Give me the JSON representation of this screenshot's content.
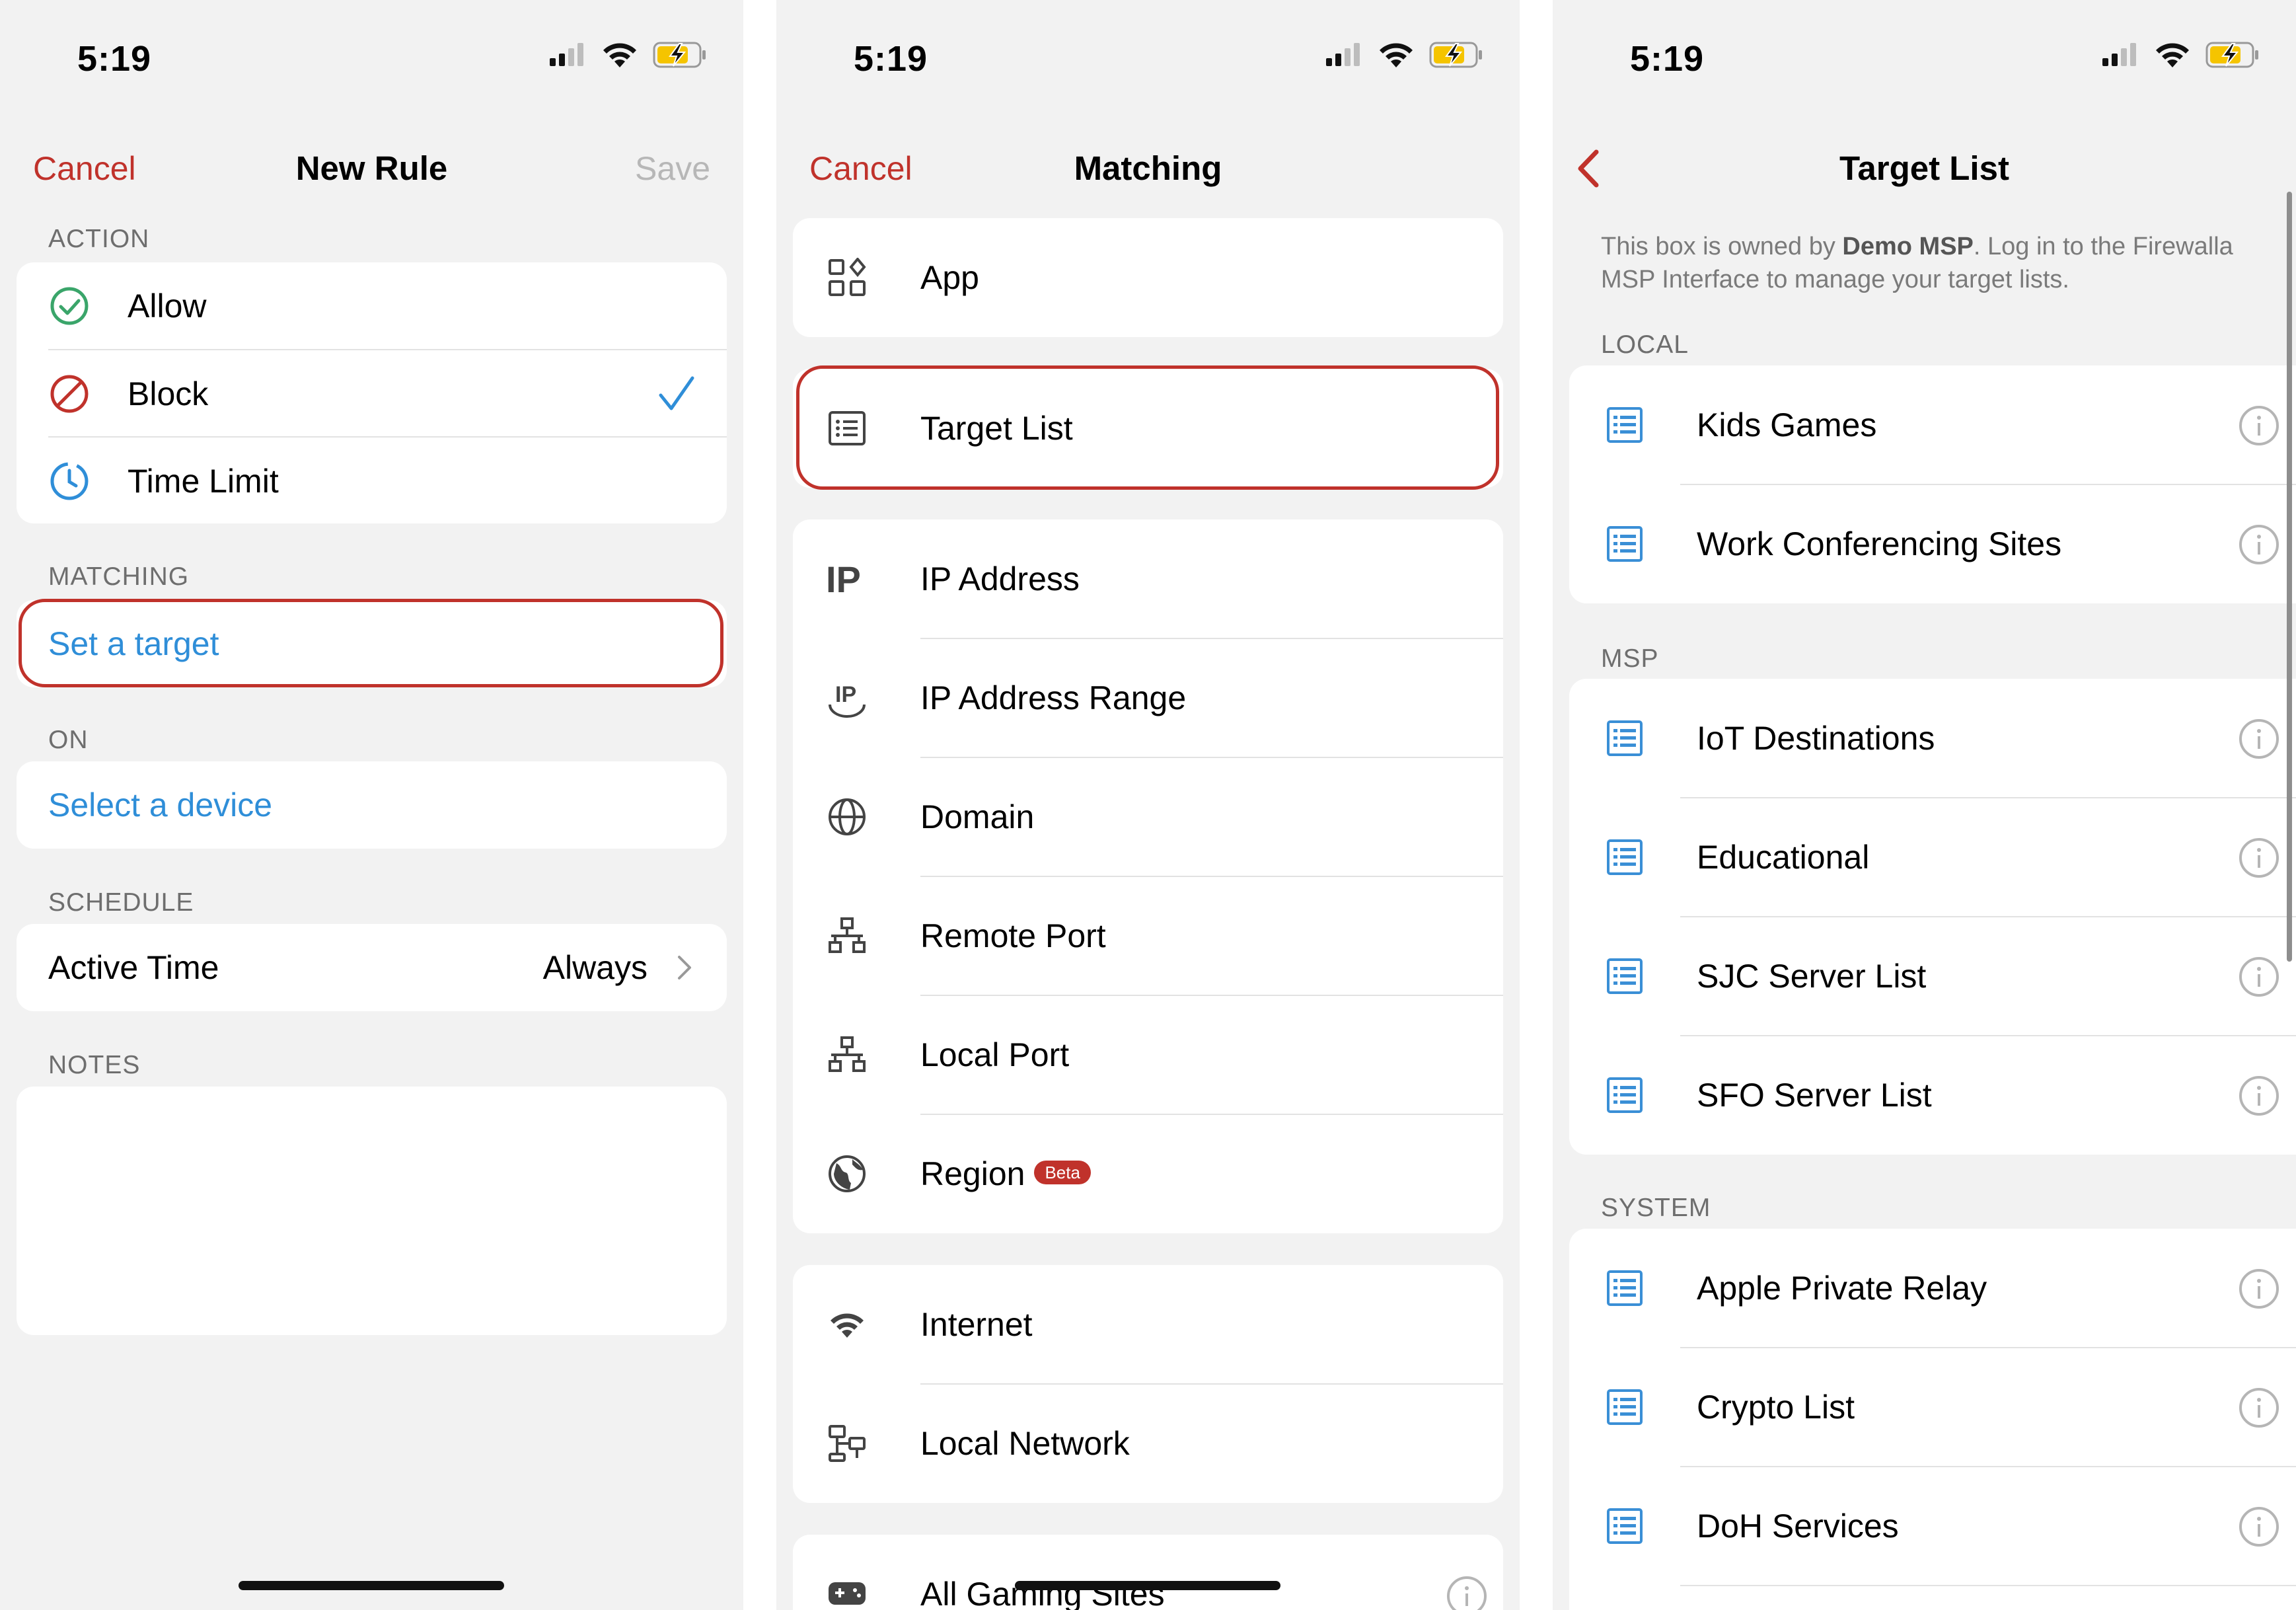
{
  "status_bar": {
    "time": "5:19"
  },
  "screen1": {
    "nav": {
      "cancel": "Cancel",
      "title": "New Rule",
      "save": "Save"
    },
    "action": {
      "header": "ACTION",
      "items": [
        {
          "label": "Allow"
        },
        {
          "label": "Block",
          "checked": true
        },
        {
          "label": "Time Limit"
        }
      ]
    },
    "matching": {
      "header": "MATCHING",
      "placeholder": "Set a target"
    },
    "on": {
      "header": "ON",
      "placeholder": "Select a device"
    },
    "schedule": {
      "header": "SCHEDULE",
      "label": "Active Time",
      "value": "Always"
    },
    "notes": {
      "header": "NOTES"
    }
  },
  "screen2": {
    "nav": {
      "cancel": "Cancel",
      "title": "Matching"
    },
    "items": {
      "app": "App",
      "target_list": "Target List",
      "ip_address": "IP Address",
      "ip_range": "IP Address Range",
      "domain": "Domain",
      "remote_port": "Remote Port",
      "local_port": "Local Port",
      "region": "Region",
      "region_badge": "Beta",
      "internet": "Internet",
      "local_network": "Local Network",
      "all_gaming": "All Gaming Sites"
    }
  },
  "screen3": {
    "nav": {
      "title": "Target List"
    },
    "notice": {
      "prefix": "This box is owned by ",
      "owner": "Demo MSP",
      "suffix": ". Log in to the Firewalla MSP Interface to manage your target lists."
    },
    "local": {
      "header": "LOCAL",
      "items": [
        "Kids Games",
        "Work Conferencing Sites"
      ]
    },
    "msp": {
      "header": "MSP",
      "items": [
        "IoT Destinations",
        "Educational",
        "SJC Server List",
        "SFO Server List"
      ]
    },
    "system": {
      "header": "SYSTEM",
      "items": [
        "Apple Private Relay",
        "Crypto List",
        "DoH Services"
      ]
    }
  },
  "colors": {
    "accent_red": "#c0322b",
    "link_blue": "#2f8ed8",
    "allow_green": "#3aa56a",
    "list_icon_blue": "#3a8fd6"
  }
}
